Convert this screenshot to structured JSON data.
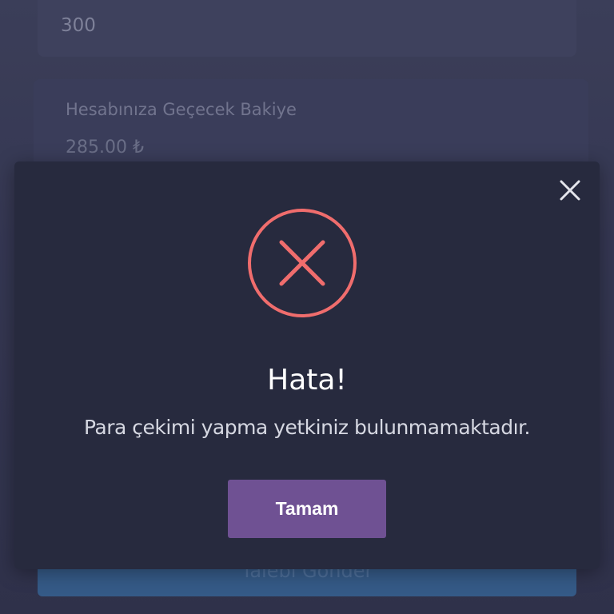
{
  "form": {
    "amount_value": "300",
    "balance_label": "Hesabınıza Geçecek Bakiye",
    "balance_amount": "285.00 ₺",
    "submit_label": "Talebi Gönder"
  },
  "dialog": {
    "icon": "error-x-circle-icon",
    "title": "Hata!",
    "message": "Para çekimi yapma yetkiniz bulunmamaktadır.",
    "ok_label": "Tamam",
    "close_icon": "close-icon"
  },
  "colors": {
    "error": "#f06d6d",
    "ok_button": "#6f5193",
    "dialog_bg": "#272a3e",
    "submit_button": "#3e6fa6"
  }
}
